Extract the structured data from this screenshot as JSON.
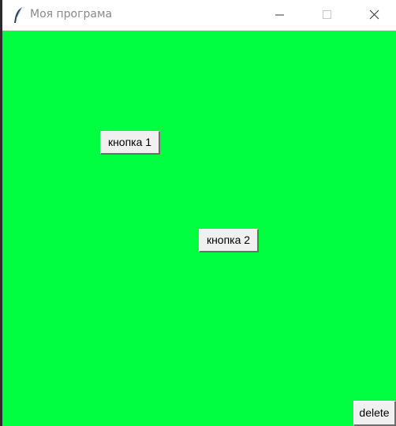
{
  "window": {
    "title": "Моя програма",
    "app_icon": "feather-icon",
    "controls": {
      "minimize": "minimize-icon",
      "maximize": "maximize-icon",
      "close": "close-icon"
    }
  },
  "canvas": {
    "background_color": "#00ff40",
    "buttons": {
      "button1_label": "кнопка 1",
      "button2_label": "кнопка 2",
      "delete_label": "delete"
    }
  }
}
